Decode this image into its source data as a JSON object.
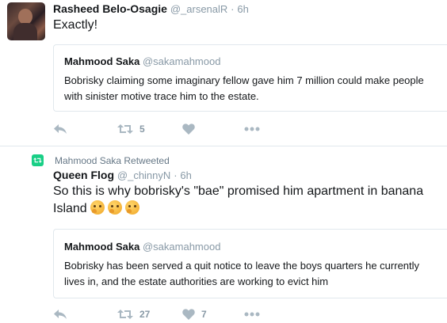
{
  "tweets": [
    {
      "author_name": "Rasheed Belo-Osagie",
      "handle": "@_arsenalR",
      "separator": "·",
      "time": "6h",
      "text": "Exactly!",
      "quoted": {
        "author_name": "Mahmood Saka",
        "handle": "@sakamahmood",
        "text": "Bobrisky claiming some imaginary fellow gave him 7 million could make people with sinister motive trace him to the estate."
      },
      "actions": {
        "retweet_count": "5",
        "like_count": ""
      }
    },
    {
      "retweeted_by": "Mahmood Saka Retweeted",
      "author_name": "Queen Flog",
      "handle": "@_chinnyN",
      "separator": "·",
      "time": "6h",
      "text": "So this is why bobrisky's \"bae\" promised him apartment in banana Island",
      "emoji_names": [
        "thinking-face-emoji",
        "thinking-face-emoji",
        "thinking-face-emoji"
      ],
      "quoted": {
        "author_name": "Mahmood Saka",
        "handle": "@sakamahmood",
        "text": "Bobrisky has been served a quit notice to leave the boys quarters he currently lives in, and the estate authorities are working to evict him"
      },
      "actions": {
        "retweet_count": "27",
        "like_count": "7"
      }
    }
  ],
  "colors": {
    "icon": "#aab8c2",
    "muted": "#8899a6",
    "border": "#e1e8ed",
    "retweet_badge": "#19cf86"
  }
}
